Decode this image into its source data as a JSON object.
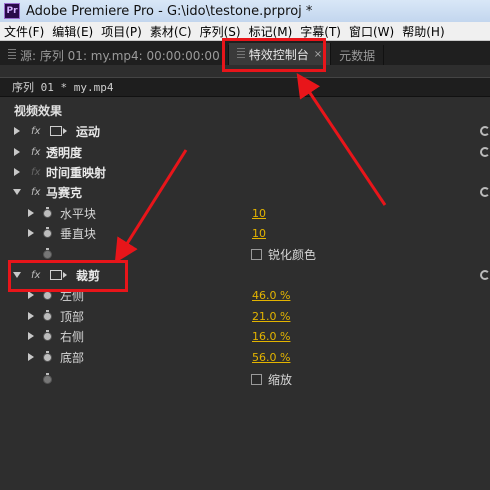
{
  "app": {
    "icon_letter": "Pr",
    "title": "Adobe Premiere Pro - G:\\ido\\testone.prproj *"
  },
  "menu": [
    "文件(F)",
    "编辑(E)",
    "项目(P)",
    "素材(C)",
    "序列(S)",
    "标记(M)",
    "字幕(T)",
    "窗口(W)",
    "帮助(H)"
  ],
  "tabs": {
    "source": "源: 序列 01: my.mp4: 00:00:00:00",
    "effect_controls": "特效控制台",
    "close": "×",
    "metadata": "元数据"
  },
  "sequence_label": "序列 01 * my.mp4",
  "section_title": "视频效果",
  "effects": {
    "motion": "运动",
    "opacity": "透明度",
    "time_remap": "时间重映射",
    "mosaic": {
      "label": "马赛克",
      "h_blocks_label": "水平块",
      "h_blocks_value": "10",
      "v_blocks_label": "垂直块",
      "v_blocks_value": "10",
      "sharpen_label": "锐化颜色"
    },
    "crop": {
      "label": "裁剪",
      "left_label": "左侧",
      "left_value": "46.0",
      "left_unit": "%",
      "top_label": "顶部",
      "top_value": "21.0",
      "top_unit": "%",
      "right_label": "右侧",
      "right_value": "16.0",
      "right_unit": "%",
      "bottom_label": "底部",
      "bottom_value": "56.0",
      "bottom_unit": "%",
      "zoom_label": "缩放"
    }
  },
  "fx_label": "fx",
  "colors": {
    "accent": "#e3b400",
    "annotation": "#e8151a"
  }
}
